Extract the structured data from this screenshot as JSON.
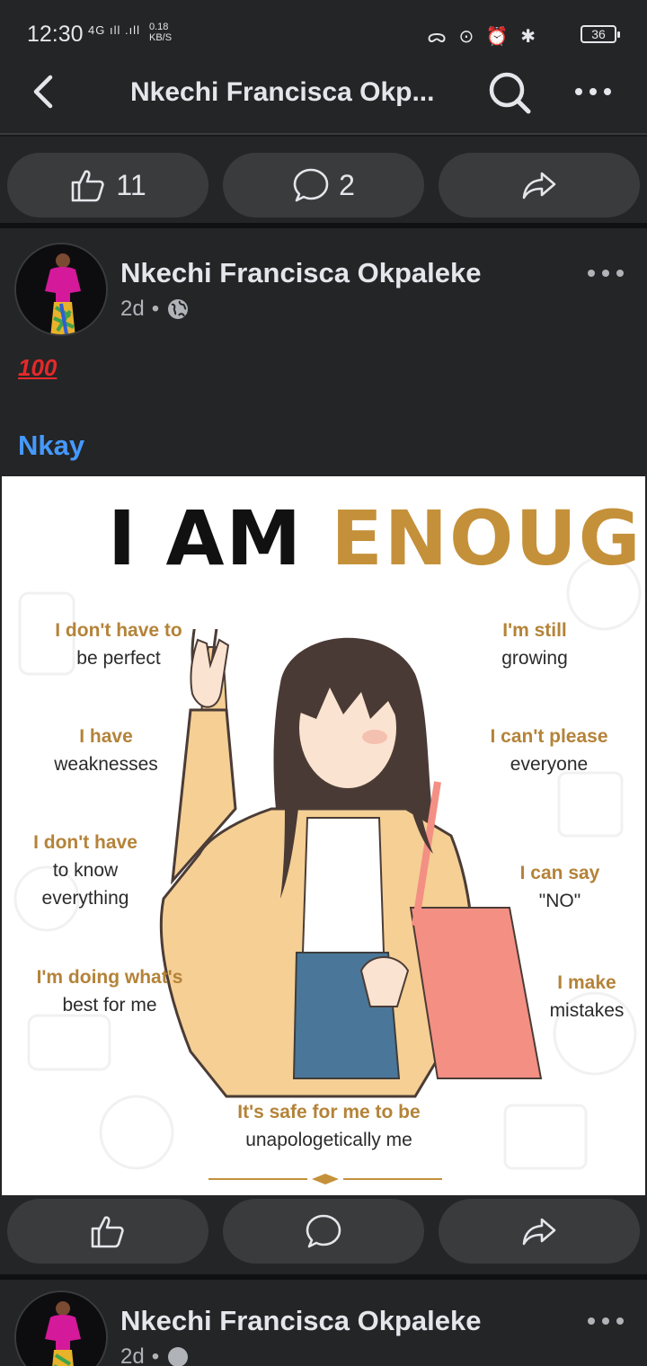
{
  "status_bar": {
    "time": "12:30",
    "network": "4G ıll .ıll",
    "speed_value": "0.18",
    "speed_unit": "KB/S",
    "icons": "ᯅ ⊙ ⏰ ✱",
    "battery": "36"
  },
  "nav": {
    "title": "Nkechi Francisca Okp...",
    "back_icon": "chevron-left-icon",
    "search_icon": "search-icon",
    "more_icon": "more-horizontal-icon"
  },
  "top_actions": {
    "like_count": "11",
    "comment_count": "2"
  },
  "post": {
    "author": "Nkechi Francisca Okpaleke",
    "time": "2d",
    "audience_icon": "globe-icon",
    "emoji_text": "100",
    "tag": "Nkay",
    "image": {
      "title_part1": "I AM",
      "title_part2": "ENOUGH",
      "affirmations": {
        "a1": {
          "hl": "I don't have to",
          "rest": "be perfect"
        },
        "a2": {
          "hl": "I have",
          "rest": "weaknesses"
        },
        "a3": {
          "hl": "I don't have",
          "rest1": "to know",
          "rest2": "everything"
        },
        "a4": {
          "hl": "I'm doing what's",
          "rest": "best for me"
        },
        "a5": {
          "hl": "I'm still",
          "rest": "growing"
        },
        "a6": {
          "hl": "I can't please",
          "rest": "everyone"
        },
        "a7": {
          "hl": "I can say",
          "rest": "\"NO\""
        },
        "a8": {
          "hl": "I make",
          "rest": "mistakes"
        },
        "a9": {
          "hl": "It's safe for me to be",
          "rest": "unapologetically me"
        }
      }
    }
  },
  "next_post": {
    "author": "Nkechi Francisca Okpaleke",
    "time": "2d"
  },
  "colors": {
    "background": "#18191a",
    "surface": "#242526",
    "button": "#3a3b3c",
    "link_blue": "#4599ff",
    "gold": "#c4913a"
  }
}
